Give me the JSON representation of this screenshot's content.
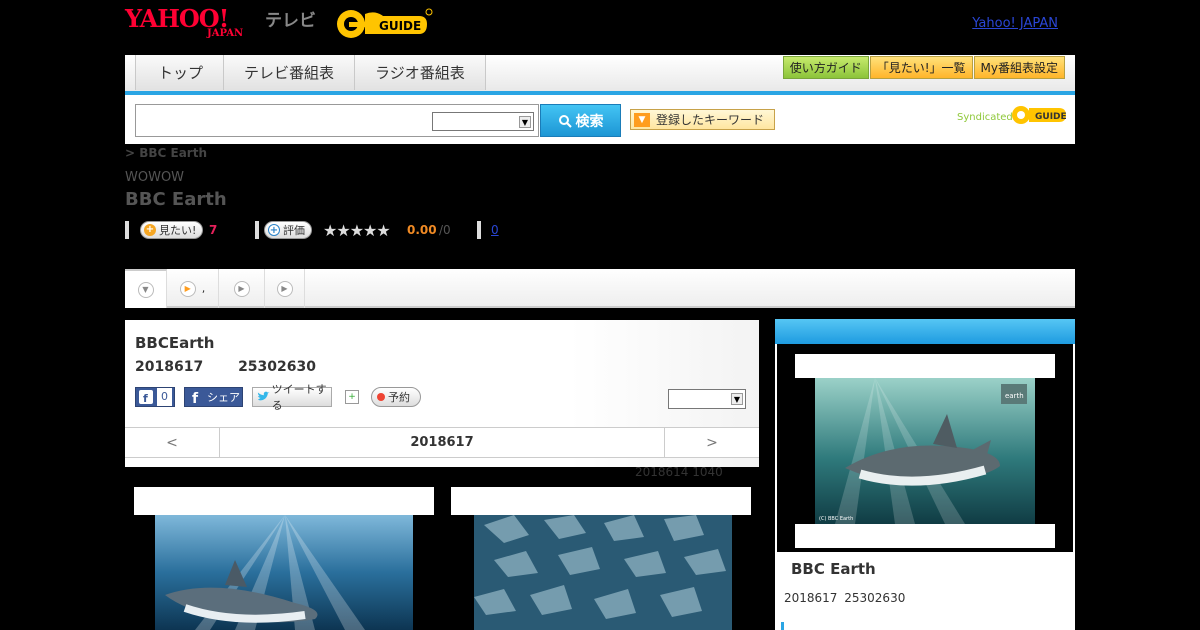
{
  "header": {
    "logo_main": "YAHOO!",
    "logo_sub": "JAPAN",
    "logo_tv": "テレビ",
    "logo_gguide": "G-GUIDE",
    "top_link": "Yahoo! JAPAN"
  },
  "nav": {
    "tabs": [
      {
        "label": "トップ"
      },
      {
        "label": "テレビ番組表"
      },
      {
        "label": "ラジオ番組表"
      }
    ],
    "buttons": [
      {
        "label": "使い方ガイド"
      },
      {
        "label": "「見たい!」一覧"
      },
      {
        "label": "My番組表設定"
      }
    ]
  },
  "search": {
    "query": "",
    "button_label": "検索",
    "keyword_label": "登録したキーワード",
    "syndicated_label": "Syndicated"
  },
  "breadcrumb": "> BBC Earth",
  "program": {
    "channel": "WOWOW",
    "title": "BBC Earth",
    "want_label": "見たい!",
    "want_count": "7",
    "rate_label": "評価",
    "stars": "★★★★★",
    "score": "0.00",
    "score_denom": "/0",
    "review_count": "0",
    "rating_value": 0
  },
  "tabstrip": {
    "tab2_label": ","
  },
  "detail": {
    "heading": "BBCEarth",
    "date_time": "2018617 25302630",
    "like_count": "0",
    "share_label": "シェア",
    "tweet_label": "ツイートする",
    "reserve_label": "予約",
    "date_prev": "<",
    "date_current": "2018617",
    "date_next": ">",
    "updated": "2018614  1040"
  },
  "side": {
    "title": "BBC Earth",
    "date_time": "2018617  25302630"
  },
  "colors": {
    "accent_blue": "#2aa5e4",
    "want_red": "#e4205a",
    "score_orange": "#f08a24",
    "link_blue": "#2a46d6"
  }
}
